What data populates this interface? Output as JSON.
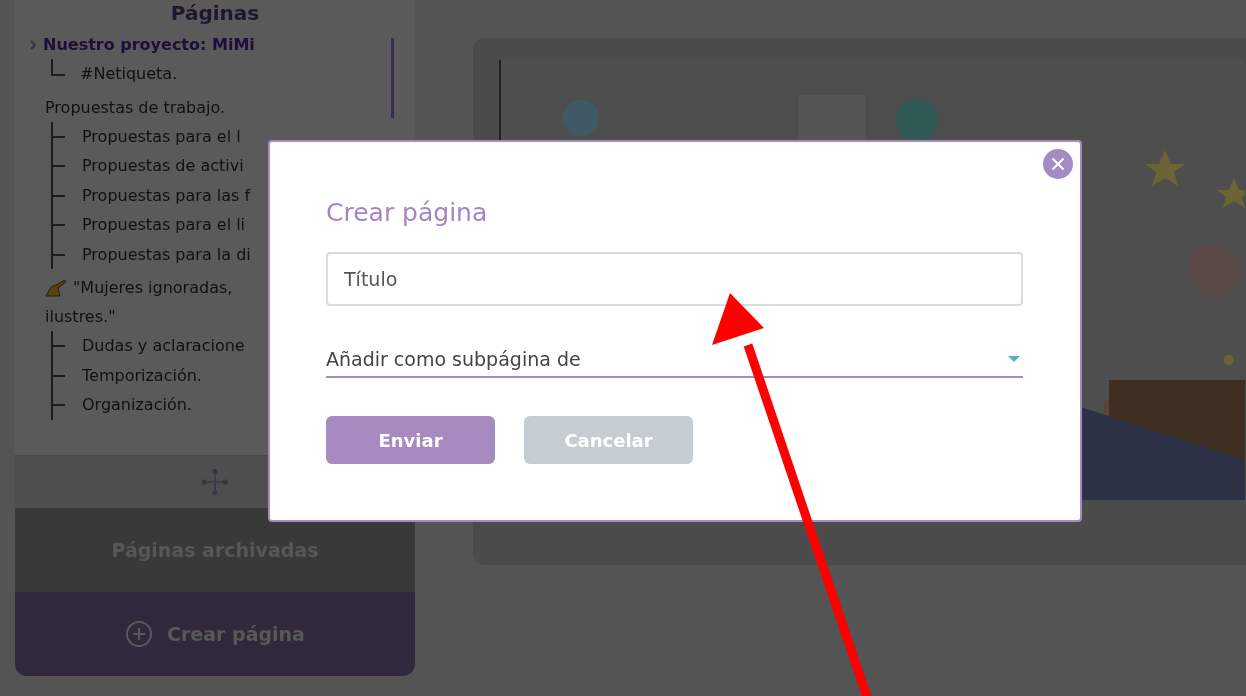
{
  "sidebar": {
    "heading": "Páginas",
    "items": [
      {
        "kind": "page",
        "label": "Nuestro proyecto: MiMi",
        "selected": true,
        "children": [
          {
            "label": "#Netiqueta."
          }
        ]
      },
      {
        "kind": "page",
        "label": "Propuestas de trabajo.",
        "selected": false,
        "children": [
          {
            "label": "Propuestas para el l"
          },
          {
            "label": "Propuestas de activi"
          },
          {
            "label": "Propuestas para las f"
          },
          {
            "label": "Propuestas para el li"
          },
          {
            "label": "Propuestas para la di"
          }
        ]
      },
      {
        "kind": "note",
        "label": "\"Mujeres ignoradas,",
        "label_2": "ilustres.\"",
        "selected": false,
        "children": [
          {
            "label": "Dudas y aclaracione"
          },
          {
            "label": "Temporización."
          },
          {
            "label": "Organización."
          }
        ]
      }
    ],
    "archived": "Páginas archivadas",
    "create": "Crear página"
  },
  "dialog": {
    "title": "Crear página",
    "title_field": {
      "placeholder": "Título"
    },
    "parent_select": {
      "placeholder": "Añadir como subpágina de"
    },
    "buttons": [
      {
        "label": "Enviar",
        "kind": "primary"
      },
      {
        "label": "Cancelar",
        "kind": "secondary"
      }
    ]
  }
}
